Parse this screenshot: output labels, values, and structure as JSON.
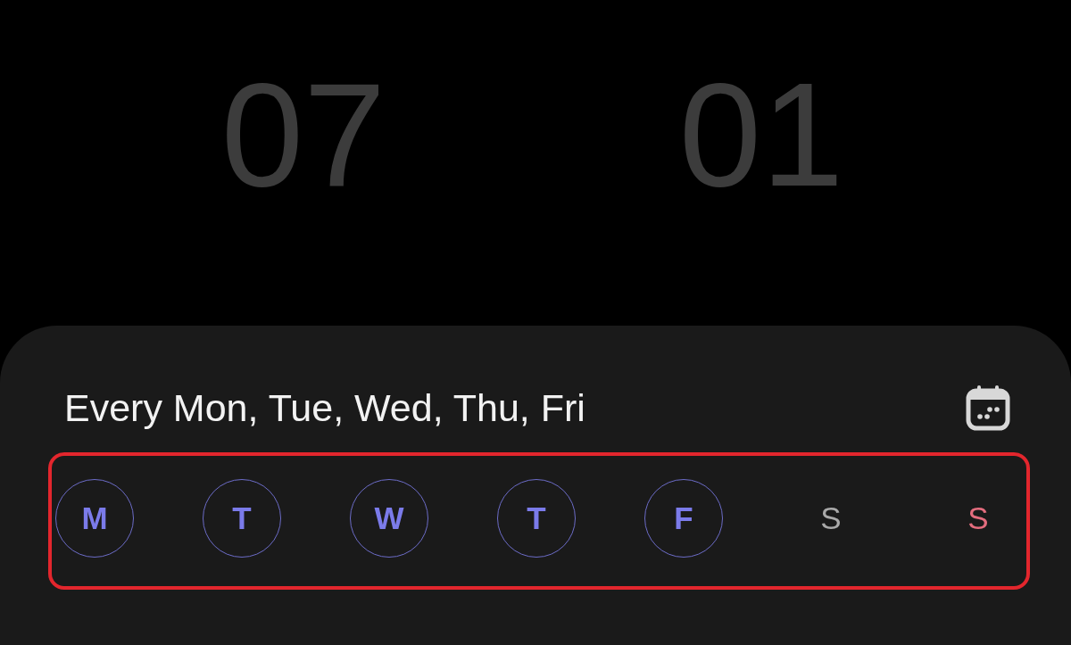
{
  "time": {
    "hour": "07",
    "minute": "01"
  },
  "repeat": {
    "summary": "Every Mon, Tue, Wed, Thu, Fri"
  },
  "days": [
    {
      "label": "M",
      "selected": true,
      "color": "#7b7bea"
    },
    {
      "label": "T",
      "selected": true,
      "color": "#7b7bea"
    },
    {
      "label": "W",
      "selected": true,
      "color": "#7b7bea"
    },
    {
      "label": "T",
      "selected": true,
      "color": "#7b7bea"
    },
    {
      "label": "F",
      "selected": true,
      "color": "#7b7bea"
    },
    {
      "label": "S",
      "selected": false,
      "color": "#a9a9a9"
    },
    {
      "label": "S",
      "selected": false,
      "color": "#e46d7e"
    }
  ]
}
